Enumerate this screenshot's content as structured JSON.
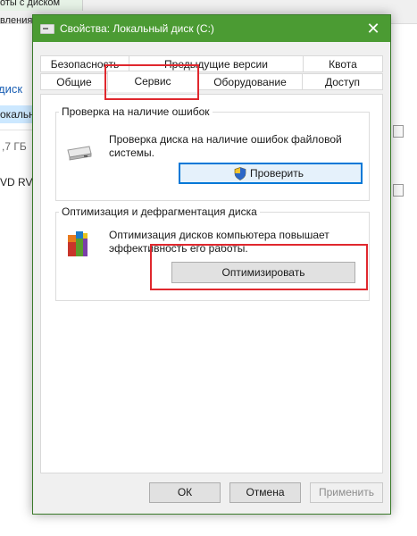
{
  "background": {
    "top_fragments": [
      "оты с диском",
      "вления"
    ],
    "left_fragments": [
      "диск",
      "окальн",
      ",7 ГБ",
      "VD RV"
    ]
  },
  "dialog": {
    "title": "Свойства: Локальный диск (C:)",
    "close_glyph": "✕"
  },
  "tabs": {
    "row_back": [
      {
        "label": "Безопасность"
      },
      {
        "label": "Предыдущие версии"
      },
      {
        "label": "Квота"
      }
    ],
    "row_front": [
      {
        "label": "Общие"
      },
      {
        "label": "Сервис",
        "active": true
      },
      {
        "label": "Оборудование"
      },
      {
        "label": "Доступ"
      }
    ]
  },
  "error_check": {
    "group_title": "Проверка на наличие ошибок",
    "description_line1": "Проверка диска на наличие ошибок файловой",
    "description_line2": "системы.",
    "button_label": "Проверить"
  },
  "optimize": {
    "group_title": "Оптимизация и дефрагментация диска",
    "description_line1": "Оптимизация дисков компьютера повышает",
    "description_line2": "эффективность его работы.",
    "button_label": "Оптимизировать"
  },
  "footer": {
    "ok_label": "ОК",
    "cancel_label": "Отмена",
    "apply_label": "Применить"
  },
  "colors": {
    "titlebar": "#4b9b33",
    "highlight": "#e0282e",
    "focus_border": "#0078d7"
  },
  "icons": {
    "drive": "hard-drive-icon",
    "defrag": "defrag-icon",
    "shield": "uac-shield-icon",
    "close": "close-icon"
  }
}
